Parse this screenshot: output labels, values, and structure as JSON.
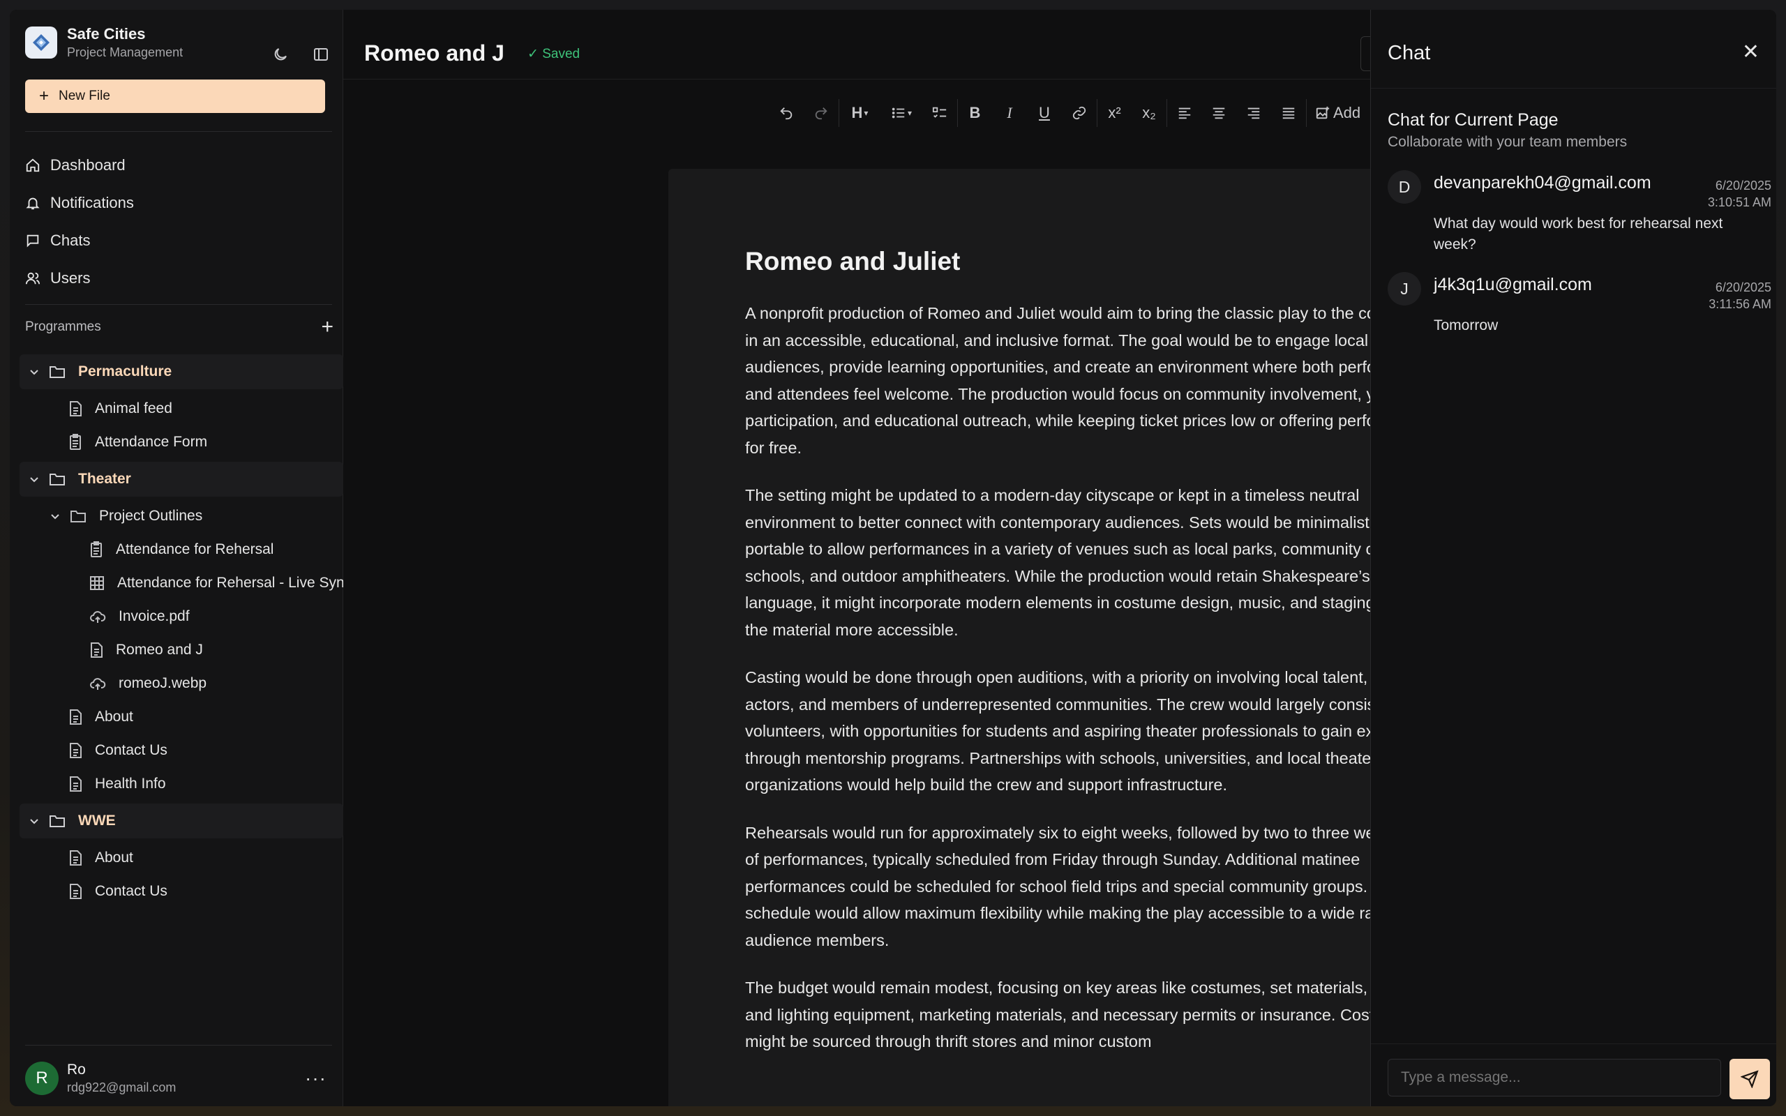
{
  "sidebar": {
    "brand_name": "Safe Cities",
    "brand_sub": "Project Management",
    "new_file": "New File",
    "nav": [
      {
        "label": "Dashboard",
        "icon": "home-icon"
      },
      {
        "label": "Notifications",
        "icon": "bell-icon"
      },
      {
        "label": "Chats",
        "icon": "chat-icon"
      },
      {
        "label": "Users",
        "icon": "users-icon"
      }
    ],
    "programmes_label": "Programmes",
    "add_symbol": "+",
    "tree": [
      {
        "label": "Permaculture",
        "level": 0,
        "kind": "folder"
      },
      {
        "label": "Animal feed",
        "level": 1,
        "kind": "doc"
      },
      {
        "label": "Attendance Form",
        "level": 1,
        "kind": "form"
      },
      {
        "label": "Theater",
        "level": 0,
        "kind": "folder"
      },
      {
        "label": "Project Outlines",
        "level": 1,
        "kind": "subfolder"
      },
      {
        "label": "Attendance for Rehersal",
        "level": 2,
        "kind": "form"
      },
      {
        "label": "Attendance for Rehersal - Live Sync",
        "level": 2,
        "kind": "table"
      },
      {
        "label": "Invoice.pdf",
        "level": 2,
        "kind": "upload"
      },
      {
        "label": "Romeo and J",
        "level": 2,
        "kind": "doc"
      },
      {
        "label": "romeoJ.webp",
        "level": 2,
        "kind": "upload"
      },
      {
        "label": "About",
        "level": 1,
        "kind": "doc"
      },
      {
        "label": "Contact Us",
        "level": 1,
        "kind": "doc"
      },
      {
        "label": "Health Info",
        "level": 1,
        "kind": "doc"
      },
      {
        "label": "WWE",
        "level": 0,
        "kind": "folder"
      },
      {
        "label": "About",
        "level": 1,
        "kind": "doc"
      },
      {
        "label": "Contact Us",
        "level": 1,
        "kind": "doc"
      }
    ],
    "user": {
      "initial": "R",
      "name": "Ro",
      "email": "rdg922@gmail.com",
      "more": "···"
    }
  },
  "editor": {
    "title": "Romeo and J",
    "saved": "✓ Saved",
    "toolbar_add": "Add",
    "doc_heading": "Romeo and Juliet",
    "paragraphs": [
      "A nonprofit production of Romeo and Juliet would aim to bring the classic play to the community in an accessible, educational, and inclusive format. The goal would be to engage local audiences, provide learning opportunities, and create an environment where both performers and attendees feel welcome. The production would focus on community involvement, youth participation, and educational outreach, while keeping ticket prices low or offering performances for free.",
      "The setting might be updated to a modern-day cityscape or kept in a timeless neutral environment to better connect with contemporary audiences. Sets would be minimalist and portable to allow performances in a variety of venues such as local parks, community centers, schools, and outdoor amphitheaters. While the production would retain Shakespeare’s original language, it might incorporate modern elements in costume design, music, and staging to make the material more accessible.",
      "Casting would be done through open auditions, with a priority on involving local talent, youth actors, and members of underrepresented communities. The crew would largely consist of volunteers, with opportunities for students and aspiring theater professionals to gain experience through mentorship programs. Partnerships with schools, universities, and local theater organizations would help build the crew and support infrastructure.",
      "Rehearsals would run for approximately six to eight weeks, followed by two to three weekends of performances, typically scheduled from Friday through Sunday. Additional matinee performances could be scheduled for school field trips and special community groups. This schedule would allow maximum flexibility while making the play accessible to a wide range of audience members.",
      "The budget would remain modest, focusing on key areas like costumes, set materials, sound and lighting equipment, marketing materials, and necessary permits or insurance. Costumes might be sourced through thrift stores and minor custom"
    ]
  },
  "chat": {
    "title": "Chat",
    "close": "✕",
    "sub_title": "Chat for Current Page",
    "sub_desc": "Collaborate with your team members",
    "messages": [
      {
        "initial": "D",
        "from": "devanparekh04@gmail.com",
        "date": "6/20/2025",
        "time": "3:10:51 AM",
        "text": "What day would work best for rehearsal next week?"
      },
      {
        "initial": "J",
        "from": "j4k3q1u@gmail.com",
        "date": "6/20/2025",
        "time": "3:11:56 AM",
        "text": "Tomorrow"
      }
    ],
    "input_placeholder": "Type a message..."
  },
  "colors": {
    "accent": "#fbd8b8",
    "saved_green": "#3ec27a",
    "avatar_green": "#1d6b34"
  }
}
